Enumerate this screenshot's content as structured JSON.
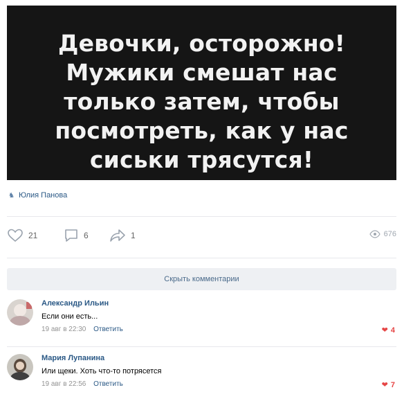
{
  "post": {
    "image_lines": [
      "Девочки, осторожно!",
      "Мужики смешат нас",
      "только затем, чтобы",
      "посмотреть, как у нас",
      "сиськи трясутся!"
    ],
    "author": "Юлия Панова"
  },
  "actions": {
    "likes": "21",
    "comments": "6",
    "shares": "1",
    "views": "676"
  },
  "hide_comments_label": "Скрыть комментарии",
  "comments": [
    {
      "name": "Александр Ильин",
      "text": "Если они есть...",
      "date": "19 авг в 22:30",
      "reply": "Ответить",
      "likes": "4"
    },
    {
      "name": "Мария Лупанина",
      "text": "Или щеки. Хоть что-то потрясется",
      "date": "19 авг в 22:56",
      "reply": "Ответить",
      "likes": "7"
    }
  ],
  "colors": {
    "link": "#2a5885",
    "like_red": "#e64646",
    "poster_bg": "#151515"
  }
}
